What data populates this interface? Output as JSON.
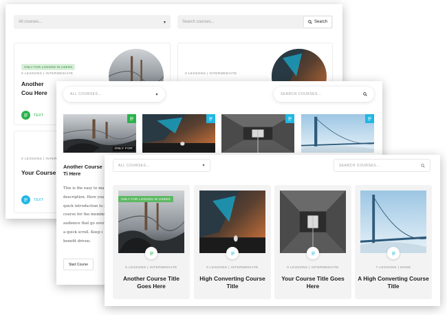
{
  "colors": {
    "green": "#2bb24c",
    "blue": "#20b7e3",
    "badge_bg": "#d8efd9",
    "card_bg": "#f3f3f3"
  },
  "panel1": {
    "select_placeholder": "All courses...",
    "search_placeholder": "Search courses...",
    "search_button": "Search",
    "cards": [
      {
        "badge": "ONLY FOR LOGGED IN USERS",
        "meta": "0 LESSONS  |  INTERMEDIATE",
        "title": "Another Cou Here",
        "button": "TEXT",
        "dot_color": "#2bb24c"
      },
      {
        "meta": "0 LESSONS  |  INTERMEDIATE"
      },
      {
        "meta": "0 LESSONS  |  INTERMEDIATE",
        "title": "Your Course T",
        "button": "TEXT",
        "dot_color": "#20b7e3"
      }
    ]
  },
  "panel2": {
    "select_placeholder": "ALL COURSES...",
    "search_placeholder": "SEARCH COURSES...",
    "thumb_lock": "ONLY FOR",
    "title": "Another Course Ti Here",
    "description_lines": [
      "This is the easy to ma",
      "description. Here you",
      "quick introduction to y",
      "course for the membe",
      "audience that go over",
      "a quick scroll. Keep i",
      "benefit driven."
    ],
    "start_button": "Start Course"
  },
  "panel3": {
    "select_placeholder": "ALL COURSES...",
    "search_placeholder": "SEARCH COURSES...",
    "cards": [
      {
        "badge": "ONLY FOR LOGGED IN USERS",
        "meta": "0 LESSONS  |  INTERMEDIATE",
        "title": "Another Course Title Goes Here"
      },
      {
        "meta": "0 LESSONS  |  INTERMEDIATE",
        "title": "High Converting Course Title"
      },
      {
        "meta": "0 LESSONS  |  INTERMEDIATE",
        "title": "Your Course Title Goes Here"
      },
      {
        "meta": "7 LESSONS  |  NONE",
        "title": "A High Converting Course Title"
      }
    ]
  }
}
